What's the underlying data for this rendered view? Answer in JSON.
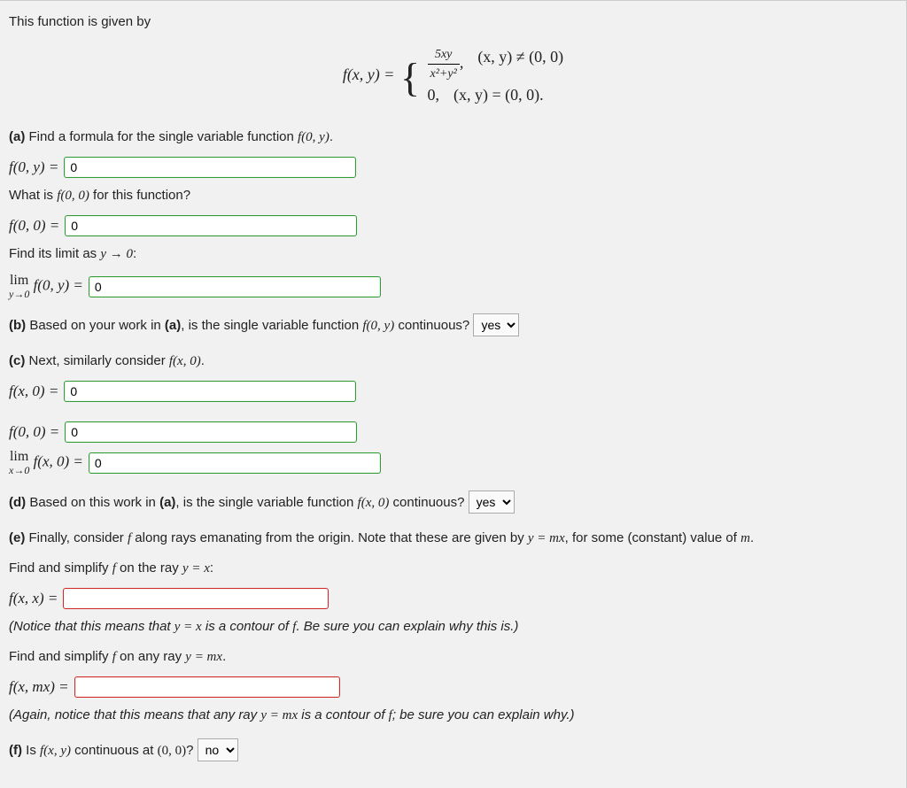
{
  "intro": "This function is given by",
  "equation": {
    "lhs": "f(x, y) =",
    "case1_expr_num": "5xy",
    "case1_expr_den": "x²+y²",
    "case1_cond": "(x, y) ≠ (0, 0)",
    "case2_expr": "0,",
    "case2_cond": "(x, y) = (0, 0)."
  },
  "a": {
    "prompt": "(a) Find a formula for the single variable function f(0, y).",
    "row1_label": "f(0, y) =",
    "row1_value": "0",
    "q2": "What is f(0, 0) for this function?",
    "row2_label": "f(0, 0) =",
    "row2_value": "0",
    "q3": "Find its limit as y → 0:",
    "row3_top": "lim",
    "row3_bot": "y→0",
    "row3_after": " f(0, y) =",
    "row3_value": "0"
  },
  "b": {
    "prompt_before": "(b) Based on your work in (a), is the single variable function f(0, y) continuous?",
    "select": "yes"
  },
  "c": {
    "prompt": "(c) Next, similarly consider f(x, 0).",
    "row1_label": "f(x, 0) =",
    "row1_value": "0",
    "row2_label": "f(0, 0) =",
    "row2_value": "0",
    "row3_top": "lim",
    "row3_bot": "x→0",
    "row3_after": " f(x, 0) =",
    "row3_value": "0"
  },
  "d": {
    "prompt_before": "(d) Based on this work in (a), is the single variable function f(x, 0) continuous?",
    "select": "yes"
  },
  "e": {
    "prompt": "(e) Finally, consider f along rays emanating from the origin. Note that these are given by y = mx, for some (constant) value of m.",
    "find1": "Find and simplify f on the ray y = x:",
    "row1_label": "f(x, x) =",
    "row1_value": "",
    "note1": "(Notice that this means that y = x is a contour of f. Be sure you can explain why this is.)",
    "find2": "Find and simplify f on any ray y = mx.",
    "row2_label": "f(x, mx) =",
    "row2_value": "",
    "note2": "(Again, notice that this means that any ray y = mx is a contour of f; be sure you can explain why.)"
  },
  "f": {
    "prompt": "(f) Is f(x, y) continuous at (0, 0)?",
    "select": "no"
  }
}
